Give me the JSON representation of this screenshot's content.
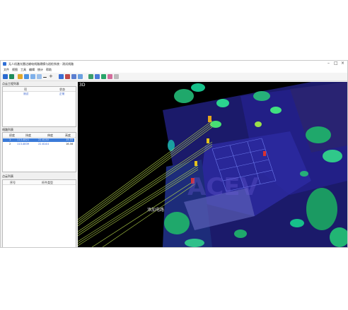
{
  "window": {
    "title": "无人机激光雷达输电线路建模与巡检系统 - 测试线路"
  },
  "menu": [
    "文件",
    "视图",
    "工具",
    "编辑",
    "统计",
    "帮助"
  ],
  "panels": {
    "project": {
      "title": "点云工程列表",
      "headers": [
        "项",
        "状态"
      ],
      "rows": [
        {
          "name": "测试",
          "status": "正常"
        }
      ]
    },
    "lines": {
      "title": "线路列表",
      "headers": [
        "经度",
        "纬度",
        "伸度",
        "高度"
      ],
      "rows": [
        {
          "id": "1",
          "lng": "113.4821",
          "lat": "22.6130",
          "alt": "15.31"
        },
        {
          "id": "2",
          "lng": "113.4839",
          "lat": "22.6144",
          "alt": "16.56"
        }
      ]
    },
    "points": {
      "title": "点云列表",
      "headers": [
        "序号",
        "杆件类型"
      ]
    }
  },
  "view": {
    "mode_label": "3D",
    "overlay_text": "添加电路"
  }
}
